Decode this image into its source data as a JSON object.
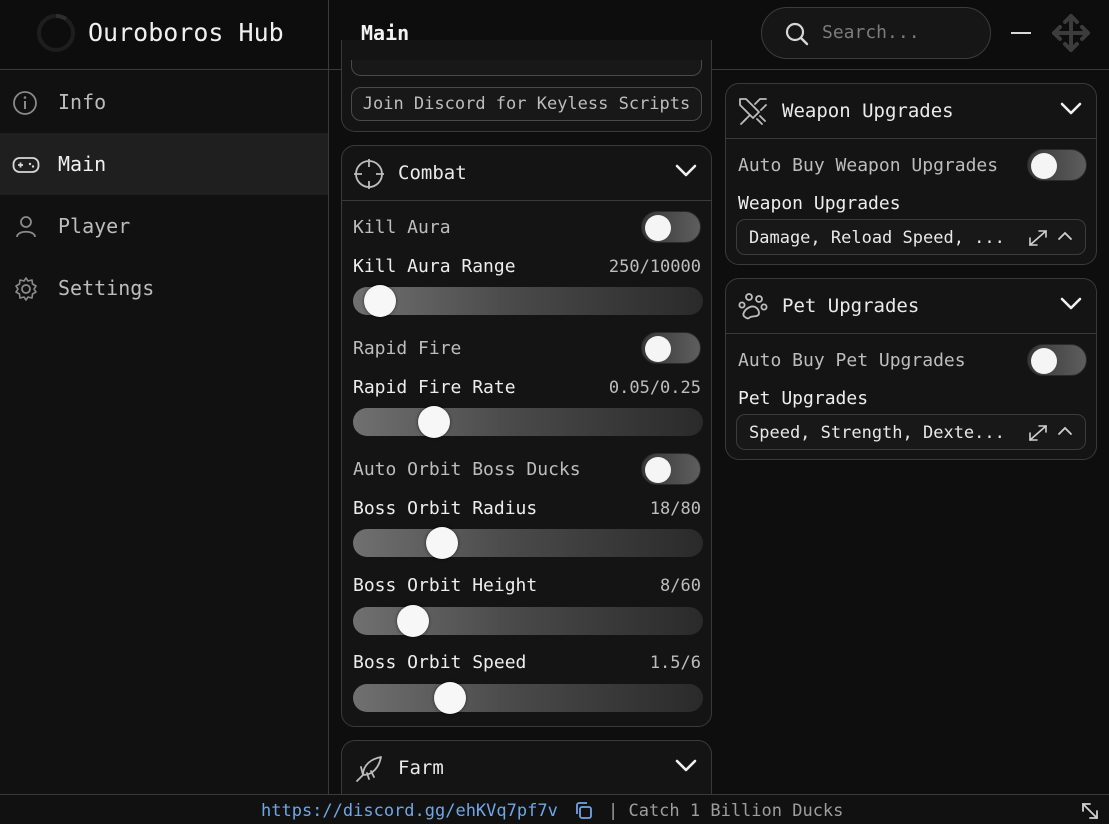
{
  "app": {
    "title": "Ouroboros Hub",
    "page_title": "Main"
  },
  "search": {
    "placeholder": "Search..."
  },
  "sidebar": {
    "items": [
      {
        "label": "Info",
        "icon": "info-icon"
      },
      {
        "label": "Main",
        "icon": "gamepad-icon",
        "active": true
      },
      {
        "label": "Player",
        "icon": "user-icon"
      },
      {
        "label": "Settings",
        "icon": "gear-icon"
      }
    ]
  },
  "discord_button": {
    "label": "Join Discord for Keyless Scripts"
  },
  "combat": {
    "title": "Combat",
    "kill_aura": {
      "label": "Kill Aura",
      "on": false
    },
    "kill_aura_range": {
      "label": "Kill Aura Range",
      "value": "250/10000",
      "fraction": 0.025
    },
    "rapid_fire": {
      "label": "Rapid Fire",
      "on": false
    },
    "rapid_fire_rate": {
      "label": "Rapid Fire Rate",
      "value": "0.05/0.25",
      "fraction": 0.2
    },
    "auto_orbit": {
      "label": "Auto Orbit Boss Ducks",
      "on": false
    },
    "boss_orbit_radius": {
      "label": "Boss Orbit Radius",
      "value": "18/80",
      "fraction": 0.225
    },
    "boss_orbit_height": {
      "label": "Boss Orbit Height",
      "value": "8/60",
      "fraction": 0.133
    },
    "boss_orbit_speed": {
      "label": "Boss Orbit Speed",
      "value": "1.5/6",
      "fraction": 0.25
    }
  },
  "farm": {
    "title": "Farm"
  },
  "weapon_upgrades": {
    "title": "Weapon Upgrades",
    "auto_buy": {
      "label": "Auto Buy Weapon Upgrades",
      "on": false
    },
    "select_label": "Weapon Upgrades",
    "select_value": "Damage, Reload Speed, ..."
  },
  "pet_upgrades": {
    "title": "Pet Upgrades",
    "auto_buy": {
      "label": "Auto Buy Pet Upgrades",
      "on": false
    },
    "select_label": "Pet Upgrades",
    "select_value": "Speed, Strength, Dexte..."
  },
  "footer": {
    "link": "https://discord.gg/ehKVq7pf7v",
    "text": "| Catch 1 Billion Ducks"
  },
  "colors": {
    "accent_link": "#6fa6e8",
    "background": "#0e0e0e",
    "panel": "#141414",
    "border": "#3a3a3a"
  }
}
